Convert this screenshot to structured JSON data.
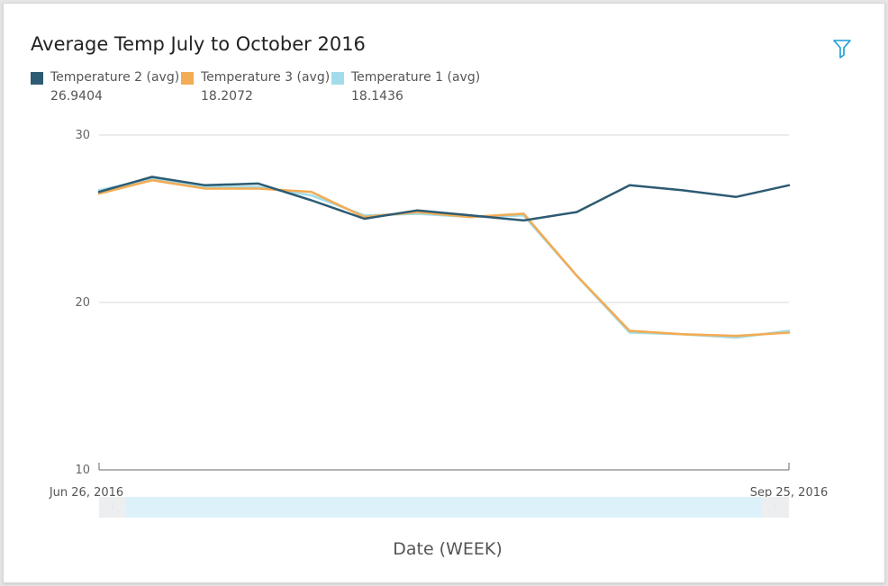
{
  "title": "Average Temp July to October 2016",
  "filter_icon": "filter-icon",
  "colors": {
    "grid": "#d8d8d8",
    "axis": "#999999",
    "accent": "#1a9bd7"
  },
  "legend": [
    {
      "name": "Temperature 2 (avg)",
      "value": "26.9404",
      "color": "#2d5b73"
    },
    {
      "name": "Temperature 3 (avg)",
      "value": "18.2072",
      "color": "#f2ac55"
    },
    {
      "name": "Temperature 1 (avg)",
      "value": "18.1436",
      "color": "#a2dceb"
    }
  ],
  "chart_data": {
    "type": "line",
    "title": "Average Temp July to October 2016",
    "xlabel": "Date (WEEK)",
    "ylabel": "",
    "ylim": [
      10,
      30
    ],
    "yticks": [
      "10",
      "20",
      "30"
    ],
    "x_start_label": "Jun 26, 2016",
    "x_end_label": "Sep 25, 2016",
    "grid": true,
    "legend_position": "top-left",
    "x": [
      "2016-06-26",
      "2016-07-03",
      "2016-07-10",
      "2016-07-17",
      "2016-07-24",
      "2016-07-31",
      "2016-08-07",
      "2016-08-14",
      "2016-08-21",
      "2016-08-28",
      "2016-09-04",
      "2016-09-11",
      "2016-09-18",
      "2016-09-25"
    ],
    "series": [
      {
        "name": "Temperature 2 (avg)",
        "color": "#2d5b73",
        "values": [
          26.6,
          27.5,
          27.0,
          27.1,
          26.1,
          25.0,
          25.5,
          25.2,
          24.9,
          25.4,
          27.0,
          26.7,
          26.3,
          27.0
        ]
      },
      {
        "name": "Temperature 3 (avg)",
        "color": "#f2ac55",
        "values": [
          26.5,
          27.3,
          26.8,
          26.8,
          26.6,
          25.1,
          25.4,
          25.1,
          25.3,
          21.6,
          18.3,
          18.1,
          18.0,
          18.2
        ]
      },
      {
        "name": "Temperature 1 (avg)",
        "color": "#a2dceb",
        "values": [
          26.7,
          27.4,
          26.9,
          26.9,
          26.4,
          25.2,
          25.3,
          25.1,
          25.2,
          21.6,
          18.2,
          18.1,
          17.9,
          18.3
        ]
      }
    ]
  }
}
